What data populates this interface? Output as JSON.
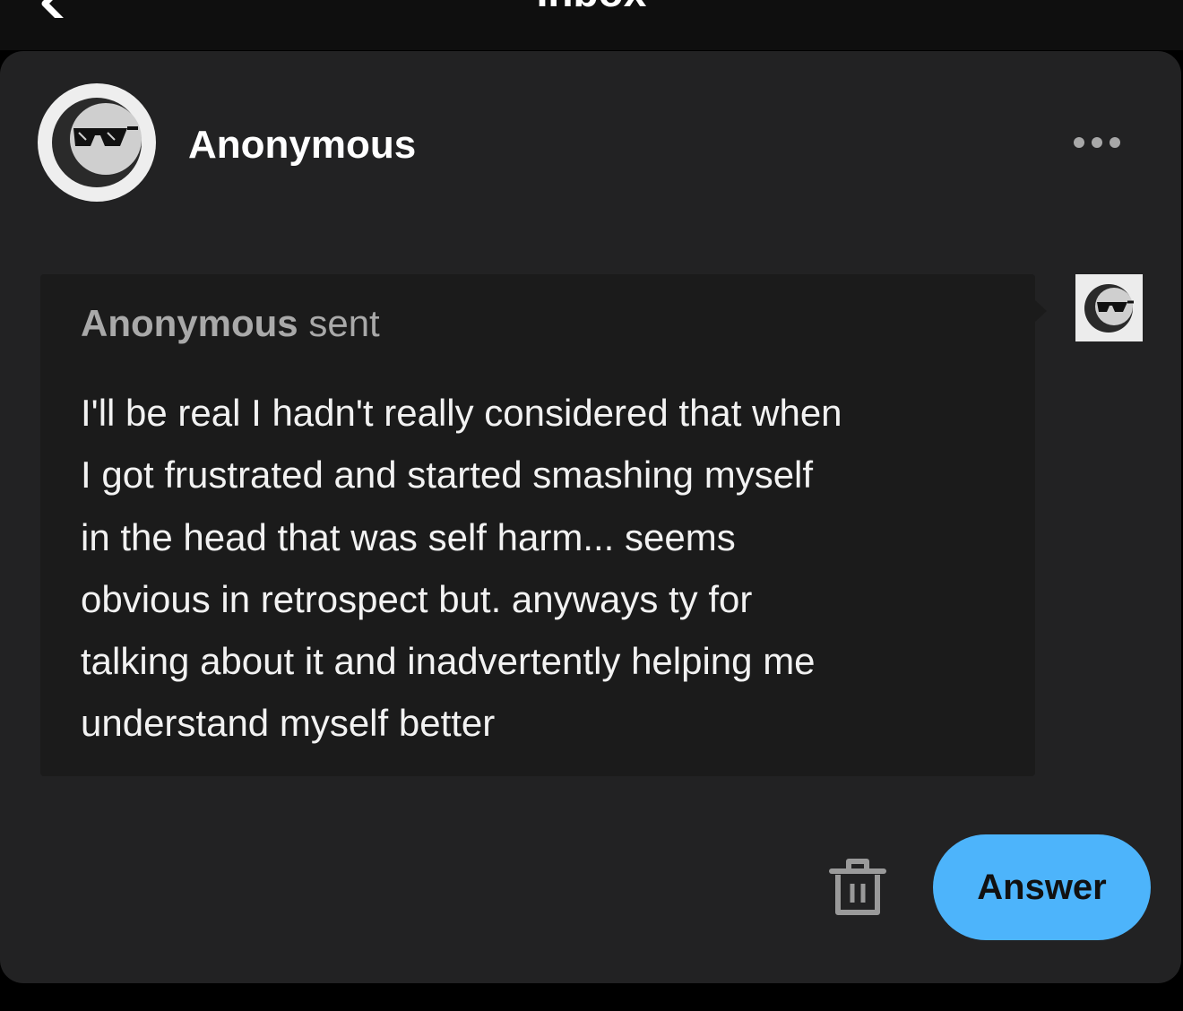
{
  "nav": {
    "title": "Inbox",
    "back_icon": "chevron-left-icon"
  },
  "ask": {
    "sender": {
      "name": "Anonymous",
      "avatar_icon": "anonymous-sunglasses-avatar"
    },
    "more_icon": "more-horizontal-icon",
    "message": {
      "from": "Anonymous",
      "verb": " sent",
      "body": "I'll be real I hadn't really considered that when\nI got frustrated and started smashing myself\nin the head that was self harm... seems\nobvious in retrospect but. anyways ty for\ntalking about it and inadvertently helping me\nunderstand myself better"
    },
    "side_avatar_icon": "anonymous-sunglasses-avatar",
    "actions": {
      "delete_icon": "trash-icon",
      "answer_label": "Answer"
    }
  },
  "colors": {
    "background": "#000000",
    "card": "#222223",
    "message_box": "#1b1b1b",
    "accent": "#4db4fb"
  }
}
